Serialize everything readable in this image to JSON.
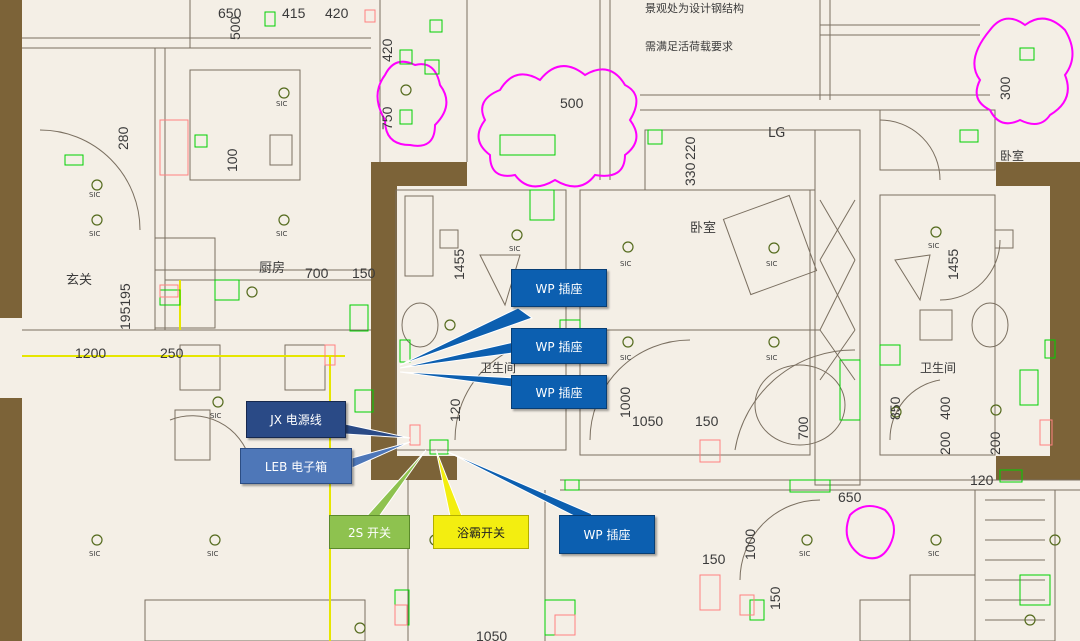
{
  "rooms": {
    "foyer": "玄关",
    "kitchen": "厨房",
    "bedroom": "卧室",
    "bath_left": "卫生间",
    "bath_right": "卫生间",
    "room_tr": "卧室"
  },
  "notes": {
    "line1": "景观处为设计钢结构",
    "line2": "需满足活荷载要求"
  },
  "dimensions": {
    "d650": "650",
    "d415": "415",
    "d420": "420",
    "d500": "500",
    "d420b": "420",
    "d280": "280",
    "d750": "750",
    "d500b": "500",
    "d220": "220",
    "d330": "330",
    "d300": "300",
    "d100": "100",
    "d700": "700",
    "d150": "150",
    "d195195": "195195",
    "d1200": "1200",
    "d250": "250",
    "d1455": "1455",
    "d1455b": "1455",
    "d1000": "1000",
    "d1050": "1050",
    "d150b": "150",
    "d700b": "700",
    "d850": "850",
    "d400": "400",
    "d200": "200",
    "d200b": "200",
    "d120": "120",
    "d650b": "650",
    "d1000b": "1000",
    "d150c": "150",
    "d150d": "150",
    "d1050b": "1050",
    "d120b": "120"
  },
  "lg_label": "LG",
  "callouts": [
    {
      "label": "WP 插座",
      "style": "blue"
    },
    {
      "label": "WP 插座",
      "style": "blue"
    },
    {
      "label": "WP 插座",
      "style": "blue"
    },
    {
      "label": "JX 电源线",
      "style": "navy"
    },
    {
      "label": "LEB 电子箱",
      "style": "lightblue"
    },
    {
      "label": "2S 开关",
      "style": "green"
    },
    {
      "label": "浴霸开关",
      "style": "yellow"
    },
    {
      "label": "WP 插座",
      "style": "blue"
    }
  ],
  "fixture_tag": "SIC",
  "colors": {
    "wall": "#7c6338",
    "line": "#7a6f60",
    "green": "#00d000",
    "magenta": "#ff00ff",
    "pink": "#ff9a9a",
    "blue_callout": "#0c5fb0",
    "yellow_line": "#e6e600"
  }
}
